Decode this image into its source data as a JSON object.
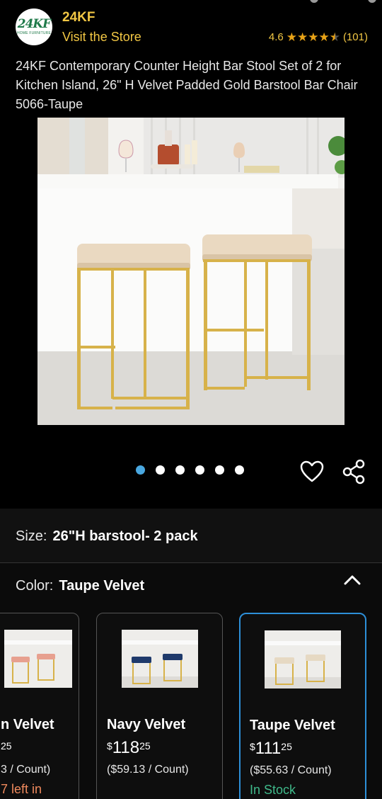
{
  "header": {
    "logo_text": "24KF",
    "logo_subtext": "HOME FURNITURE",
    "brand": "24KF",
    "visit_store": "Visit the Store",
    "rating_value": "4.6",
    "rating_count": "(101)",
    "stars": 4.6
  },
  "product": {
    "title": "24KF Contemporary Counter Height Bar Stool Set of 2 for Kitchen Island, 26\" H Velvet Padded Gold Barstool Bar Chair 5066-Taupe",
    "image_count": 6,
    "active_image": 1
  },
  "icons": {
    "favorite": "heart-icon",
    "share": "share-icon",
    "collapse": "chevron-up-icon"
  },
  "size": {
    "label": "Size:",
    "value": "26\"H barstool- 2 pack"
  },
  "color": {
    "label": "Color:",
    "value": "Taupe Velvet"
  },
  "swatches": [
    {
      "name": "n Velvet",
      "price_currency": "",
      "price_whole": "",
      "price_fraction": "25",
      "unit_price": "3 / Count)",
      "stock": "7 left in",
      "stock_color": "#f08a5d",
      "seat_color": "#e7a08f"
    },
    {
      "name": "Navy Velvet",
      "price_currency": "$",
      "price_whole": "118",
      "price_fraction": "25",
      "unit_price": "($59.13 / Count)",
      "stock": "",
      "stock_color": "#3fb98a",
      "seat_color": "#1f3a6b"
    },
    {
      "name": "Taupe Velvet",
      "price_currency": "$",
      "price_whole": "111",
      "price_fraction": "25",
      "unit_price": "($55.63 / Count)",
      "stock": "In Stock",
      "stock_color": "#3fb98a",
      "seat_color": "#e6d9c3"
    }
  ],
  "colors": {
    "accent_yellow": "#f2c744",
    "star": "#e8a317",
    "selected_border": "#2d8fd8",
    "pager_active": "#4aa8e0"
  }
}
